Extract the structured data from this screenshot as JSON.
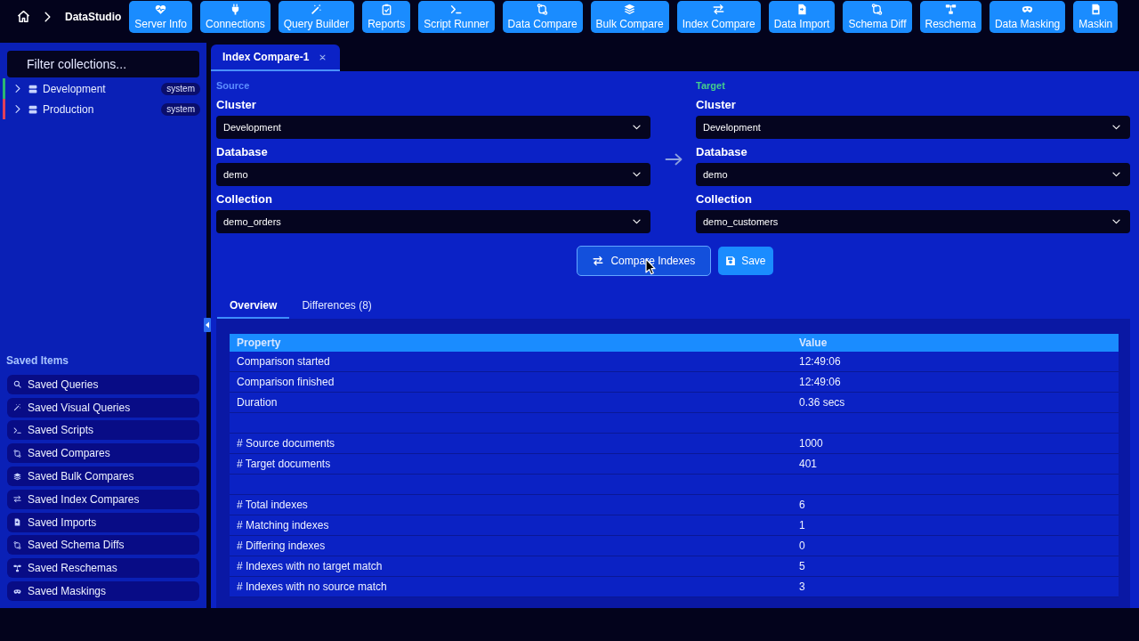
{
  "top_bar": {
    "title": "DataStudio",
    "toolbar": [
      "Server Info",
      "Connections",
      "Query Builder",
      "Reports",
      "Script Runner",
      "Data Compare",
      "Bulk Compare",
      "Index Compare",
      "Data Import",
      "Schema Diff",
      "Reschema",
      "Data Masking",
      "Maskin"
    ]
  },
  "sidebar": {
    "filter": {
      "placeholder": "Filter collections..."
    },
    "connections": [
      {
        "label": "Development",
        "badge": "system",
        "color": "#2bb673",
        "expanded": false
      },
      {
        "label": "Production",
        "badge": "system",
        "color": "#e0405a",
        "expanded": false
      }
    ],
    "saved_items": {
      "title": "Saved Items",
      "items": [
        "Saved Queries",
        "Saved Visual Queries",
        "Saved Scripts",
        "Saved Compares",
        "Saved Bulk Compares",
        "Saved Index Compares",
        "Saved Imports",
        "Saved Schema Diffs",
        "Saved Reschemas",
        "Saved Maskings"
      ]
    }
  },
  "tabs": [
    {
      "label": "Index Compare-1",
      "selected": true
    }
  ],
  "comparison": {
    "source": {
      "title": "Source",
      "fields": [
        {
          "label": "Cluster",
          "value": "Development"
        },
        {
          "label": "Database",
          "value": "demo"
        },
        {
          "label": "Collection",
          "value": "demo_orders"
        }
      ]
    },
    "target": {
      "title": "Target",
      "fields": [
        {
          "label": "Cluster",
          "value": "Development"
        },
        {
          "label": "Database",
          "value": "demo"
        },
        {
          "label": "Collection",
          "value": "demo_customers"
        }
      ]
    }
  },
  "actions": [
    {
      "label": "Compare Indexes",
      "hovered": true
    },
    {
      "label": "Save",
      "hovered": false
    }
  ],
  "result_tabs": [
    {
      "label": "Overview",
      "selected": true
    },
    {
      "label": "Differences (8)",
      "selected": false
    }
  ],
  "table": {
    "columns": [
      "Property",
      "Value"
    ],
    "groups": [
      [
        {
          "property": "Comparison started",
          "value": "12:49:06"
        },
        {
          "property": "Comparison finished",
          "value": "12:49:06"
        },
        {
          "property": "Duration",
          "value": "0.36 secs"
        }
      ],
      [
        {
          "property": "# Source documents",
          "value": "1000"
        },
        {
          "property": "# Target documents",
          "value": "401"
        }
      ],
      [
        {
          "property": "# Total indexes",
          "value": "6"
        },
        {
          "property": "# Matching indexes",
          "value": "1"
        },
        {
          "property": "# Differing indexes",
          "value": "0"
        },
        {
          "property": "# Indexes with no target match",
          "value": "5"
        },
        {
          "property": "# Indexes with no source match",
          "value": "3"
        }
      ]
    ]
  }
}
